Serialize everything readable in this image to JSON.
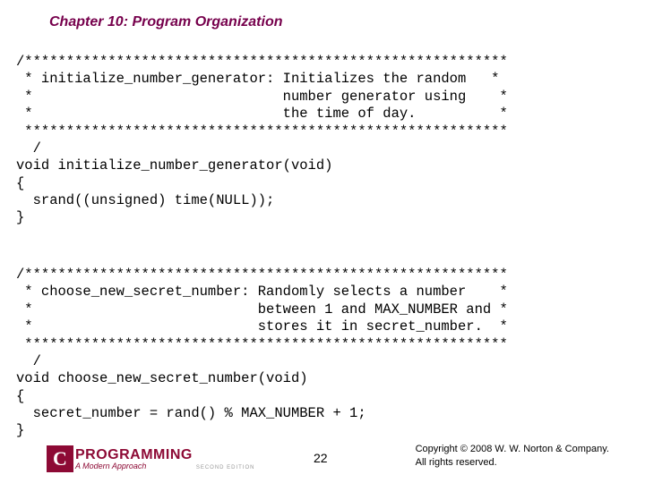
{
  "chapter": "Chapter 10: Program Organization",
  "code_block_1": "/**********************************************************\n * initialize_number_generator: Initializes the random   *\n *                              number generator using    *\n *                              the time of day.          *\n **********************************************************\n  /\nvoid initialize_number_generator(void)\n{\n  srand((unsigned) time(NULL));\n}",
  "code_block_2": "/**********************************************************\n * choose_new_secret_number: Randomly selects a number    *\n *                           between 1 and MAX_NUMBER and *\n *                           stores it in secret_number.  *\n **********************************************************\n  /\nvoid choose_new_secret_number(void)\n{\n  secret_number = rand() % MAX_NUMBER + 1;\n}",
  "logo": {
    "letter": "C",
    "main": "PROGRAMMING",
    "sub": "A Modern Approach",
    "edition": "SECOND EDITION"
  },
  "page_number": "22",
  "copyright_line1": "Copyright © 2008 W. W. Norton & Company.",
  "copyright_line2": "All rights reserved."
}
